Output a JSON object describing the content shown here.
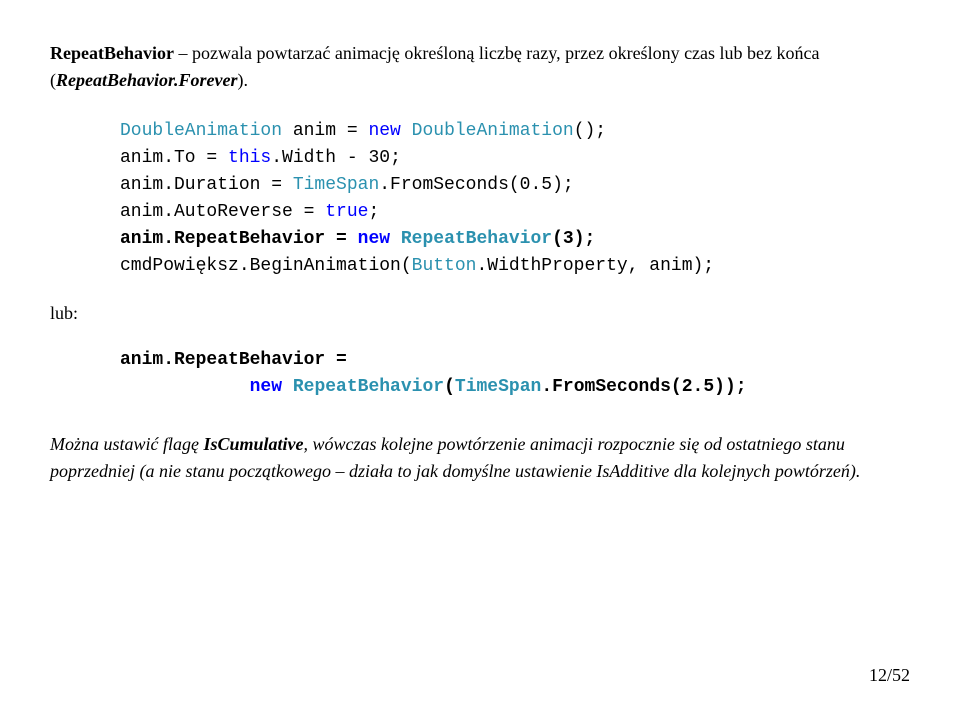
{
  "intro": {
    "b1": "RepeatBehavior",
    "t1": " – pozwala powtarzać animację określoną liczbę razy, przez określony czas lub bez końca (",
    "b2": "RepeatBehavior.Forever",
    "t2": ")."
  },
  "code1": {
    "l1a": "DoubleAnimation",
    "l1b": " anim = ",
    "l1c": "new",
    "l1d": " ",
    "l1e": "DoubleAnimation",
    "l1f": "();",
    "l2a": "anim.To = ",
    "l2b": "this",
    "l2c": ".Width - 30;",
    "l3a": "anim.Duration = ",
    "l3b": "TimeSpan",
    "l3c": ".FromSeconds(0.5);",
    "l4a": "anim.AutoReverse = ",
    "l4b": "true",
    "l4c": ";",
    "l5a": "anim.RepeatBehavior = ",
    "l5b": "new",
    "l5c": " ",
    "l5d": "RepeatBehavior",
    "l5e": "(3);",
    "l6a": "cmdPowiększ.BeginAnimation(",
    "l6b": "Button",
    "l6c": ".WidthProperty, anim);"
  },
  "lub": "lub:",
  "code2": {
    "l1a": "anim.RepeatBehavior =",
    "l2a": "            ",
    "l2b": "new",
    "l2c": " ",
    "l2d": "RepeatBehavior",
    "l2e": "(",
    "l2f": "TimeSpan",
    "l2g": ".FromSeconds(2.5));"
  },
  "outro": {
    "t1": "Można ustawić flagę ",
    "b1": "IsCumulative",
    "t2": ", wówczas kolejne powtórzenie animacji rozpocznie się od ostatniego stanu poprzedniej (a nie stanu początkowego – działa to jak domyślne ustawienie IsAdditive dla kolejnych powtórzeń)."
  },
  "pageNum": "12/52"
}
